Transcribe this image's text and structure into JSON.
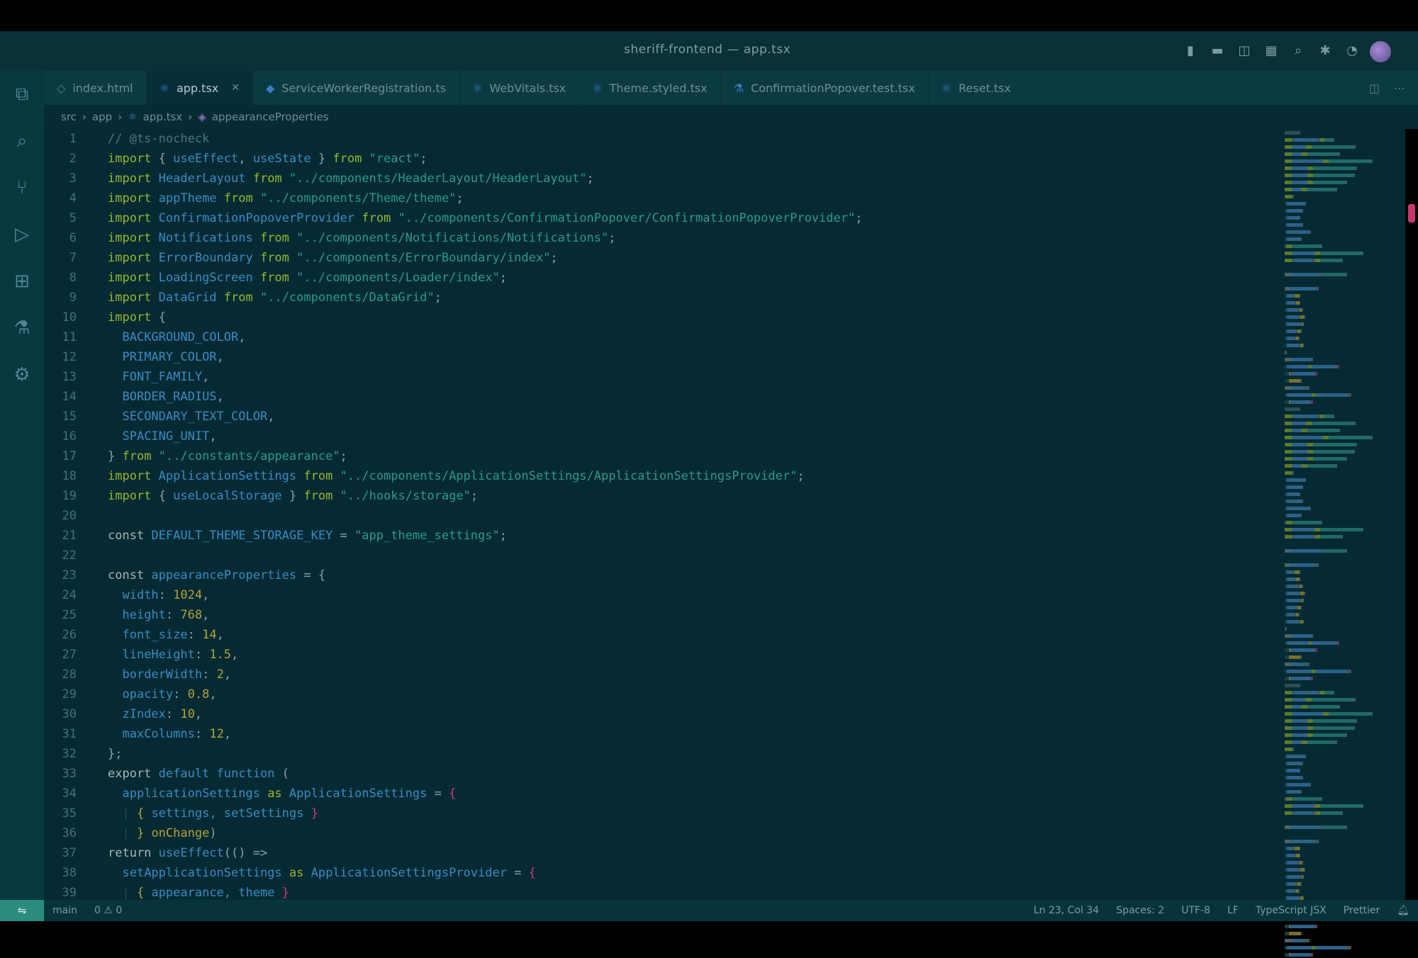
{
  "window": {
    "title": "sheriff-frontend — app.tsx",
    "title_icons": [
      "layout-sidebar-icon",
      "layout-panel-icon",
      "layout-split-icon",
      "layout-custom-icon",
      "search-icon",
      "extensions-icon",
      "accounts-icon"
    ]
  },
  "activity_bar": [
    "explorer-icon",
    "search-icon",
    "source-control-icon",
    "run-debug-icon",
    "extensions-icon",
    "testing-icon",
    "docker-icon"
  ],
  "tabs": [
    {
      "label": "index.html",
      "icon": "html-icon",
      "active": false
    },
    {
      "label": "app.tsx",
      "icon": "react-icon",
      "active": true
    },
    {
      "label": "ServiceWorkerRegistration.ts",
      "icon": "ts-icon",
      "active": false
    },
    {
      "label": "WebVitals.tsx",
      "icon": "react-icon",
      "active": false
    },
    {
      "label": "Theme.styled.tsx",
      "icon": "react-icon",
      "active": false
    },
    {
      "label": "ConfirmationPopover.test.tsx",
      "icon": "test-icon",
      "active": false
    },
    {
      "label": "Reset.tsx",
      "icon": "react-icon",
      "active": false
    }
  ],
  "breadcrumb": [
    "src",
    "app",
    "app.tsx",
    "appearanceProperties"
  ],
  "code_lines": [
    {
      "n": "1",
      "parts": [
        [
          "cm",
          "// @ts-nocheck"
        ]
      ]
    },
    {
      "n": "2",
      "parts": [
        [
          "kw",
          "import"
        ],
        [
          "pun",
          " { "
        ],
        [
          "id",
          "useEffect"
        ],
        [
          "pun",
          ", "
        ],
        [
          "id",
          "useState"
        ],
        [
          "pun",
          " } "
        ],
        [
          "kw",
          "from"
        ],
        [
          "str",
          " \"react\""
        ],
        [
          "pun",
          ";"
        ]
      ]
    },
    {
      "n": "3",
      "parts": [
        [
          "kw",
          "import"
        ],
        [
          "id",
          " HeaderLayout"
        ],
        [
          "kw",
          " from"
        ],
        [
          "str",
          " \"../components/HeaderLayout/HeaderLayout\""
        ],
        [
          "pun",
          ";"
        ]
      ]
    },
    {
      "n": "4",
      "parts": [
        [
          "kw",
          "import"
        ],
        [
          "id",
          " appTheme"
        ],
        [
          "kw",
          " from"
        ],
        [
          "str",
          " \"../components/Theme/theme\""
        ],
        [
          "pun",
          ";"
        ]
      ]
    },
    {
      "n": "5",
      "parts": [
        [
          "kw",
          "import"
        ],
        [
          "id",
          " ConfirmationPopoverProvider"
        ],
        [
          "kw",
          " from"
        ],
        [
          "str",
          " \"../components/ConfirmationPopover/ConfirmationPopoverProvider\""
        ],
        [
          "pun",
          ";"
        ]
      ]
    },
    {
      "n": "6",
      "parts": [
        [
          "kw",
          "import"
        ],
        [
          "id",
          " Notifications"
        ],
        [
          "kw",
          " from"
        ],
        [
          "str",
          " \"../components/Notifications/Notifications\""
        ],
        [
          "pun",
          ";"
        ]
      ]
    },
    {
      "n": "7",
      "parts": [
        [
          "kw",
          "import"
        ],
        [
          "id",
          " ErrorBoundary"
        ],
        [
          "kw",
          " from"
        ],
        [
          "str",
          " \"../components/ErrorBoundary/index\""
        ],
        [
          "pun",
          ";"
        ]
      ]
    },
    {
      "n": "8",
      "parts": [
        [
          "kw",
          "import"
        ],
        [
          "id",
          " LoadingScreen"
        ],
        [
          "kw",
          " from"
        ],
        [
          "str",
          " \"../components/Loader/index\""
        ],
        [
          "pun",
          ";"
        ]
      ]
    },
    {
      "n": "9",
      "parts": [
        [
          "kw",
          "import"
        ],
        [
          "id",
          " DataGrid"
        ],
        [
          "kw",
          " from"
        ],
        [
          "str",
          " \"../components/DataGrid\""
        ],
        [
          "pun",
          ";"
        ]
      ]
    },
    {
      "n": "10",
      "parts": [
        [
          "kw",
          "import"
        ],
        [
          "pun",
          " {"
        ]
      ]
    },
    {
      "n": "11",
      "parts": [
        [
          "guide",
          "  "
        ],
        [
          "id",
          "BACKGROUND_COLOR"
        ],
        [
          "pun",
          ","
        ]
      ]
    },
    {
      "n": "12",
      "parts": [
        [
          "guide",
          "  "
        ],
        [
          "id",
          "PRIMARY_COLOR"
        ],
        [
          "pun",
          ","
        ]
      ]
    },
    {
      "n": "13",
      "parts": [
        [
          "guide",
          "  "
        ],
        [
          "id",
          "FONT_FAMILY"
        ],
        [
          "pun",
          ","
        ]
      ]
    },
    {
      "n": "14",
      "parts": [
        [
          "guide",
          "  "
        ],
        [
          "id",
          "BORDER_RADIUS"
        ],
        [
          "pun",
          ","
        ]
      ]
    },
    {
      "n": "15",
      "parts": [
        [
          "guide",
          "  "
        ],
        [
          "id",
          "SECONDARY_TEXT_COLOR"
        ],
        [
          "pun",
          ","
        ]
      ]
    },
    {
      "n": "16",
      "parts": [
        [
          "guide",
          "  "
        ],
        [
          "id",
          "SPACING_UNIT"
        ],
        [
          "pun",
          ","
        ]
      ]
    },
    {
      "n": "17",
      "parts": [
        [
          "pun",
          "} "
        ],
        [
          "kw",
          "from"
        ],
        [
          "str",
          " \"../constants/appearance\""
        ],
        [
          "pun",
          ";"
        ]
      ]
    },
    {
      "n": "18",
      "parts": [
        [
          "kw",
          "import"
        ],
        [
          "id",
          " ApplicationSettings"
        ],
        [
          "kw",
          " from"
        ],
        [
          "str",
          " \"../components/ApplicationSettings/ApplicationSettingsProvider\""
        ],
        [
          "pun",
          ";"
        ]
      ]
    },
    {
      "n": "19",
      "parts": [
        [
          "kw",
          "import"
        ],
        [
          "pun",
          " { "
        ],
        [
          "id",
          "useLocalStorage"
        ],
        [
          "pun",
          " } "
        ],
        [
          "kw",
          "from"
        ],
        [
          "str",
          " \"../hooks/storage\""
        ],
        [
          "pun",
          ";"
        ]
      ]
    },
    {
      "n": "20",
      "parts": []
    },
    {
      "n": "21",
      "parts": [
        [
          "kw2",
          "const"
        ],
        [
          "id",
          " DEFAULT_THEME_STORAGE_KEY"
        ],
        [
          "pun",
          " = "
        ],
        [
          "str",
          "\"app_theme_settings\""
        ],
        [
          "pun",
          ";"
        ]
      ]
    },
    {
      "n": "22",
      "parts": []
    },
    {
      "n": "23",
      "parts": [
        [
          "kw2",
          "const"
        ],
        [
          "id",
          " appearanceProperties"
        ],
        [
          "pun",
          " = {"
        ]
      ]
    },
    {
      "n": "24",
      "parts": [
        [
          "guide",
          "  "
        ],
        [
          "id",
          "width"
        ],
        [
          "pun",
          ": "
        ],
        [
          "num",
          "1024"
        ],
        [
          "pun",
          ","
        ]
      ]
    },
    {
      "n": "25",
      "parts": [
        [
          "guide",
          "  "
        ],
        [
          "id",
          "height"
        ],
        [
          "pun",
          ": "
        ],
        [
          "num",
          "768"
        ],
        [
          "pun",
          ","
        ]
      ]
    },
    {
      "n": "26",
      "parts": [
        [
          "guide",
          "  "
        ],
        [
          "id",
          "font_size"
        ],
        [
          "pun",
          ": "
        ],
        [
          "num",
          "14"
        ],
        [
          "pun",
          ","
        ]
      ]
    },
    {
      "n": "27",
      "parts": [
        [
          "guide",
          "  "
        ],
        [
          "id",
          "lineHeight"
        ],
        [
          "pun",
          ": "
        ],
        [
          "num",
          "1.5"
        ],
        [
          "pun",
          ","
        ]
      ]
    },
    {
      "n": "28",
      "parts": [
        [
          "guide",
          "  "
        ],
        [
          "id",
          "borderWidth"
        ],
        [
          "pun",
          ": "
        ],
        [
          "num",
          "2"
        ],
        [
          "pun",
          ","
        ]
      ]
    },
    {
      "n": "29",
      "parts": [
        [
          "guide",
          "  "
        ],
        [
          "id",
          "opacity"
        ],
        [
          "pun",
          ": "
        ],
        [
          "num",
          "0.8"
        ],
        [
          "pun",
          ","
        ]
      ]
    },
    {
      "n": "30",
      "parts": [
        [
          "guide",
          "  "
        ],
        [
          "id",
          "zIndex"
        ],
        [
          "pun",
          ": "
        ],
        [
          "num",
          "10"
        ],
        [
          "pun",
          ","
        ]
      ]
    },
    {
      "n": "31",
      "parts": [
        [
          "guide",
          "  "
        ],
        [
          "id",
          "maxColumns"
        ],
        [
          "pun",
          ": "
        ],
        [
          "num",
          "12"
        ],
        [
          "pun",
          ","
        ]
      ]
    },
    {
      "n": "32",
      "parts": [
        [
          "pun",
          "};"
        ]
      ]
    },
    {
      "n": "33",
      "parts": [
        [
          "kw2",
          "export"
        ],
        [
          "id",
          " default"
        ],
        [
          "id",
          " function"
        ],
        [
          "pun",
          " ("
        ]
      ]
    },
    {
      "n": "34",
      "parts": [
        [
          "guide",
          "  "
        ],
        [
          "id",
          "applicationSettings"
        ],
        [
          "kw",
          " as"
        ],
        [
          "id",
          " ApplicationSettings"
        ],
        [
          "pun",
          " = "
        ],
        [
          "err",
          "{"
        ]
      ]
    },
    {
      "n": "35",
      "parts": [
        [
          "guide",
          "  | "
        ],
        [
          "num",
          "{"
        ],
        [
          "id",
          " settings, setSettings"
        ],
        [
          "err",
          " }"
        ]
      ]
    },
    {
      "n": "36",
      "parts": [
        [
          "guide",
          "  | "
        ],
        [
          "num",
          "}"
        ],
        [
          "num",
          " onChange"
        ],
        [
          "pun",
          ")"
        ]
      ]
    },
    {
      "n": "37",
      "parts": [
        [
          "kw2",
          "return"
        ],
        [
          "id",
          " useEffect"
        ],
        [
          "pun",
          "(() "
        ],
        [
          "pun",
          "=>"
        ]
      ]
    },
    {
      "n": "38",
      "parts": [
        [
          "guide",
          "  "
        ],
        [
          "id",
          "setApplicationSettings"
        ],
        [
          "kw",
          " as"
        ],
        [
          "id",
          " ApplicationSettingsProvider"
        ],
        [
          "pun",
          " = "
        ],
        [
          "err",
          "{"
        ]
      ]
    },
    {
      "n": "39",
      "parts": [
        [
          "guide",
          "  | "
        ],
        [
          "num",
          "{"
        ],
        [
          "id",
          " appearance, theme"
        ],
        [
          "err",
          " }"
        ]
      ]
    }
  ],
  "status_bar": {
    "left": [
      "main",
      "0 ⚠ 0"
    ],
    "right": [
      "Ln 23, Col 34",
      "Spaces: 2",
      "UTF-8",
      "LF",
      "TypeScript JSX",
      "Prettier"
    ]
  }
}
